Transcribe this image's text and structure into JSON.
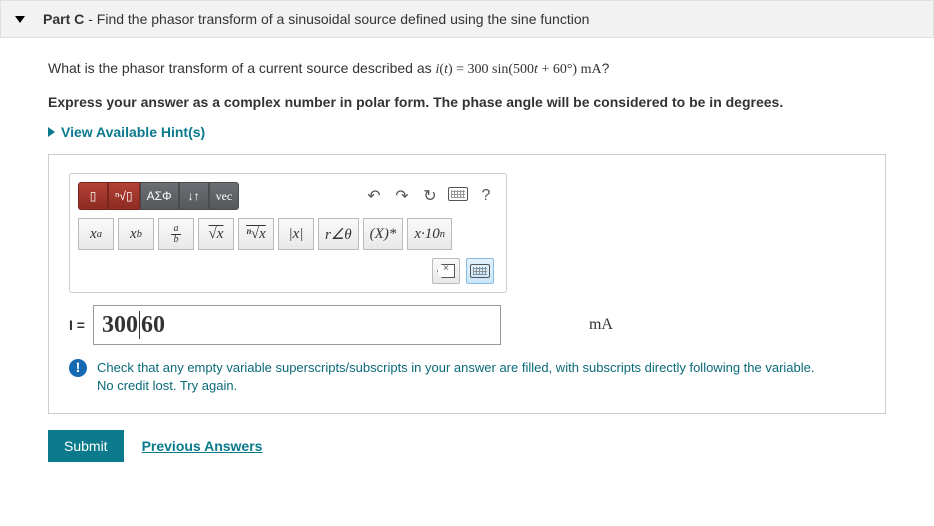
{
  "header": {
    "part_label": "Part C",
    "part_desc": " - Find the phasor transform of a sinusoidal source defined using the sine function"
  },
  "question": {
    "lead": "What is the phasor transform of a current source described as ",
    "equation_plain": "i(t) = 300 sin(500t + 60°) mA",
    "tail": "?"
  },
  "instruction": "Express your answer as a complex number in polar form. The phase angle will be considered to be in degrees.",
  "hints_link": "View Available Hint(s)",
  "toolbar": {
    "main": {
      "templates": "▯",
      "radical_tpl": "ⁿ√▯",
      "greek": "ΑΣΦ",
      "scripts": "↓↑",
      "vec": "vec"
    },
    "icons": {
      "undo": "↶",
      "redo": "↷",
      "reset": "↻",
      "help": "?"
    },
    "sub_buttons": {
      "xa": "x",
      "xb": "x",
      "frac": "a",
      "frac_b": "b",
      "sqrt": "√x",
      "nroot": "ⁿ√x",
      "abs": "|x|",
      "angle": "r∠θ",
      "conj": "(X)*",
      "sci": "x·10"
    }
  },
  "equation": {
    "label": "I =",
    "value_a": "300",
    "value_b": "60",
    "unit": "mA"
  },
  "feedback": {
    "line1": "Check that any empty variable superscripts/subscripts in your answer are filled, with subscripts directly following the variable.",
    "line2": "No credit lost. Try again."
  },
  "buttons": {
    "submit": "Submit",
    "previous": "Previous Answers"
  }
}
